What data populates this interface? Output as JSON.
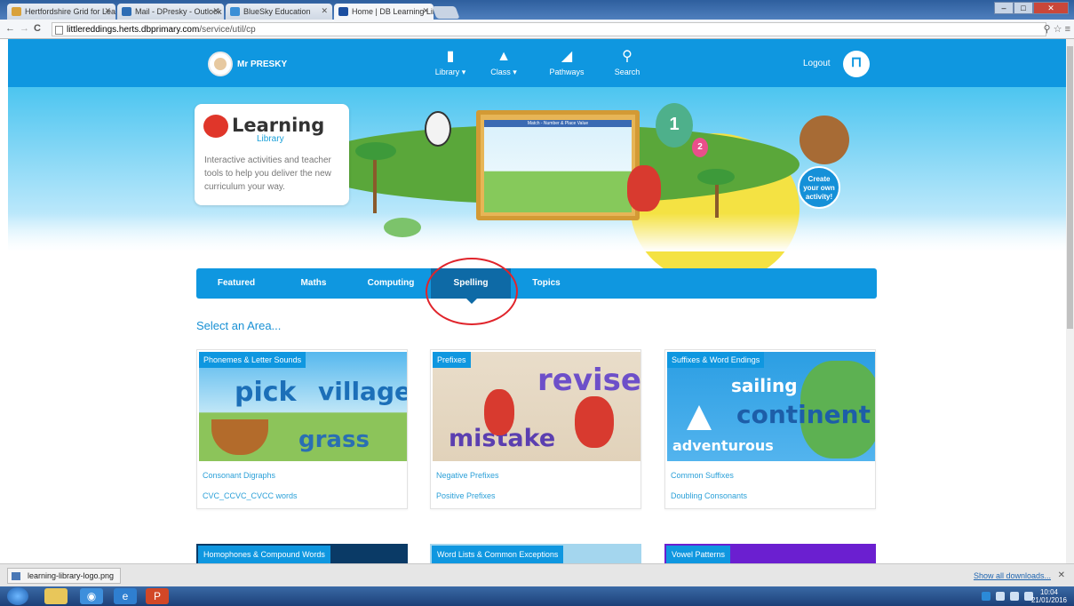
{
  "browser": {
    "tabs": [
      {
        "title": "Hertfordshire Grid for Lea",
        "color": "#d9a13a"
      },
      {
        "title": "Mail - DPresky - Outlook",
        "color": "#2e6db4"
      },
      {
        "title": "BlueSky Education",
        "color": "#3b8fd6"
      },
      {
        "title": "Home | DB Learning Libra",
        "color": "#1c4fa0"
      }
    ],
    "url_host": "littlereddings.herts.dbprimary.com",
    "url_path": "/service/util/cp"
  },
  "header": {
    "username": "Mr PRESKY",
    "nav": [
      {
        "label": "Library ▾",
        "icon": "book-icon",
        "glyph": "▮"
      },
      {
        "label": "Class ▾",
        "icon": "graduation-cap-icon",
        "glyph": "▲"
      },
      {
        "label": "Pathways",
        "icon": "paper-plane-icon",
        "glyph": "◢"
      },
      {
        "label": "Search",
        "icon": "search-icon",
        "glyph": "⚲"
      }
    ],
    "logout": "Logout"
  },
  "banner": {
    "brand_title": "Learning",
    "brand_sub": "Library",
    "brand_desc": "Interactive activities and teacher tools to help you deliver the new curriculum your way.",
    "create": "Create your own activity!",
    "balloon_1": "1",
    "balloon_2": "2"
  },
  "categories": [
    "Featured",
    "Maths",
    "Computing",
    "Spelling",
    "Topics"
  ],
  "active_category": "Spelling",
  "select_title": "Select an Area...",
  "cards": [
    {
      "title": "Phonemes & Letter Sounds",
      "links": [
        "Consonant Digraphs",
        "CVC_CCVC_CVCC words"
      ],
      "words": [
        "pick",
        "village",
        "grass"
      ]
    },
    {
      "title": "Prefixes",
      "links": [
        "Negative Prefixes",
        "Positive Prefixes"
      ],
      "words": [
        "revise",
        "mistake"
      ]
    },
    {
      "title": "Suffixes & Word Endings",
      "links": [
        "Common Suffixes",
        "Doubling Consonants"
      ],
      "words": [
        "sailing",
        "continent",
        "adventurous"
      ]
    }
  ],
  "cards_row2": [
    "Homophones & Compound Words",
    "Word Lists & Common Exceptions",
    "Vowel Patterns"
  ],
  "downloads": {
    "file": "learning-library-logo.png",
    "show_all": "Show all downloads..."
  },
  "taskbar": {
    "time": "10:04",
    "date": "21/01/2016"
  },
  "colors": {
    "primary": "#0f97e0",
    "active_tab": "#0e6aa6",
    "highlight_circle": "#e0242b"
  }
}
